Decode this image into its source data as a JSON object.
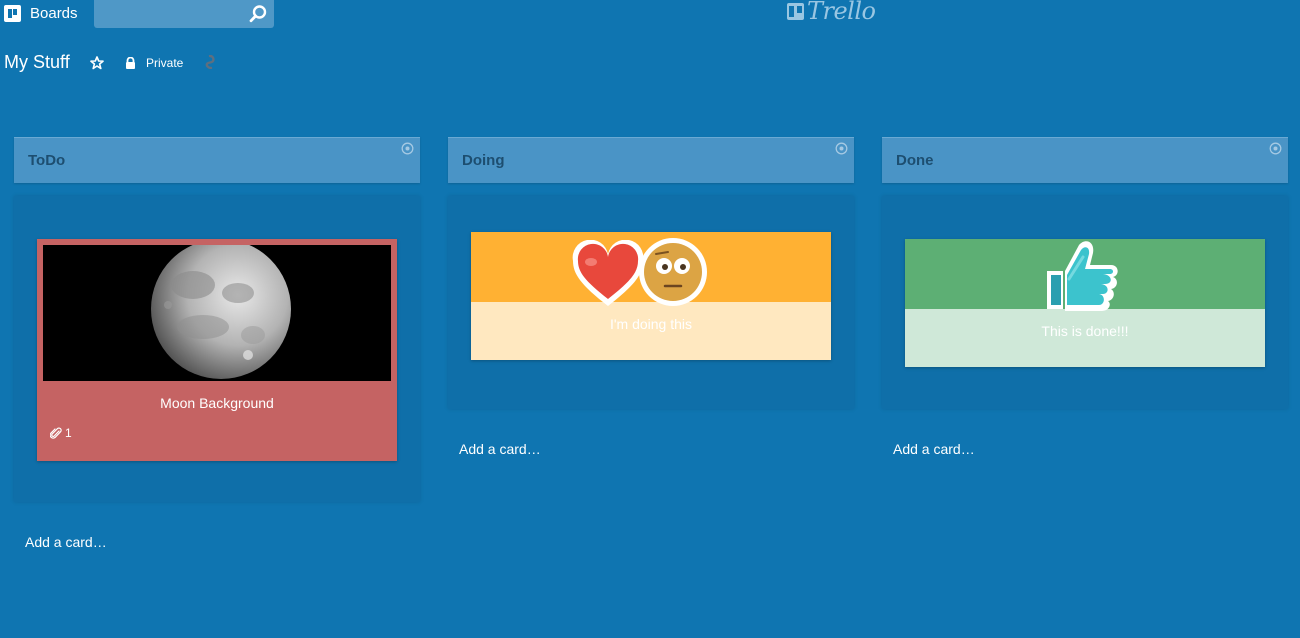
{
  "header": {
    "boards_label": "Boards",
    "search": {
      "placeholder": "",
      "value": ""
    },
    "logo_text": "Trello"
  },
  "board": {
    "title": "My Stuff",
    "privacy_label": "Private"
  },
  "colors": {
    "board_bg": "#0f75b1",
    "list_header_bg": "#4a94c6",
    "list_title": "#1d4e70",
    "card_red": "#c56363",
    "card_orange_top": "#ffb133",
    "card_orange_bottom": "#ffe8c0",
    "card_green_top": "#5daf74",
    "card_green_bottom": "#cfe8d8"
  },
  "lists": [
    {
      "name": "ToDo",
      "cards": [
        {
          "title": "Moon Background",
          "cover": "moon-image",
          "attachments": "1"
        }
      ],
      "add_card_label": "Add a card…"
    },
    {
      "name": "Doing",
      "cards": [
        {
          "title": "I'm doing this",
          "stickers": [
            "heart-sticker",
            "face-sticker"
          ]
        }
      ],
      "add_card_label": "Add a card…"
    },
    {
      "name": "Done",
      "cards": [
        {
          "title": "This is done!!!",
          "stickers": [
            "thumbs-up-sticker"
          ]
        }
      ],
      "add_card_label": "Add a card…"
    }
  ]
}
